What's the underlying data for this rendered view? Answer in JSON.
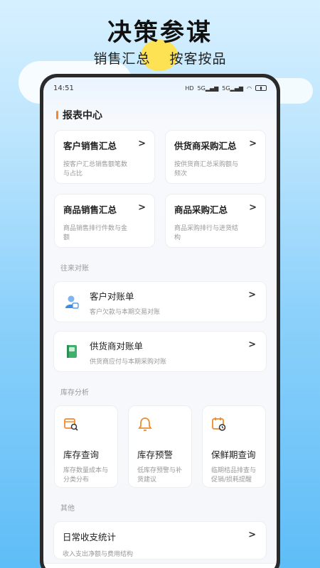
{
  "promo": {
    "headline": "决策参谋",
    "sub_left": "销售汇总",
    "sub_right": "按客按品"
  },
  "status": {
    "time": "14:51"
  },
  "report_center": {
    "title": "报表中心",
    "cards": [
      {
        "title": "客户销售汇总",
        "desc": "按客户汇总销售额笔数与占比"
      },
      {
        "title": "供货商采购汇总",
        "desc": "按供货商汇总采购额与频次"
      },
      {
        "title": "商品销售汇总",
        "desc": "商品销售排行件数与金额"
      },
      {
        "title": "商品采购汇总",
        "desc": "商品采购排行与进货结构"
      }
    ]
  },
  "reconciliation": {
    "label": "往来对账",
    "items": [
      {
        "title": "客户对账单",
        "desc": "客户欠款与本期交易对账",
        "icon": "customer-icon"
      },
      {
        "title": "供货商对账单",
        "desc": "供货商应付与本期采购对账",
        "icon": "supplier-book-icon"
      }
    ]
  },
  "inventory": {
    "label": "库存分析",
    "items": [
      {
        "title": "库存查询",
        "desc": "库存数量成本与分类分布",
        "icon": "inventory-search-icon"
      },
      {
        "title": "库存预警",
        "desc": "低库存预警与补货建议",
        "icon": "bell-icon"
      },
      {
        "title": "保鲜期查询",
        "desc": "临期桔品排查与促销/损耗提醒",
        "icon": "calendar-clock-icon"
      }
    ]
  },
  "other": {
    "label": "其他",
    "item": {
      "title": "日常收支统计",
      "desc": "收入支出净额与费用结构"
    }
  },
  "colors": {
    "accent": "#f08a2c",
    "icon_blue": "#3a8ee6",
    "icon_green": "#3db06b",
    "icon_orange": "#f08a2c"
  }
}
